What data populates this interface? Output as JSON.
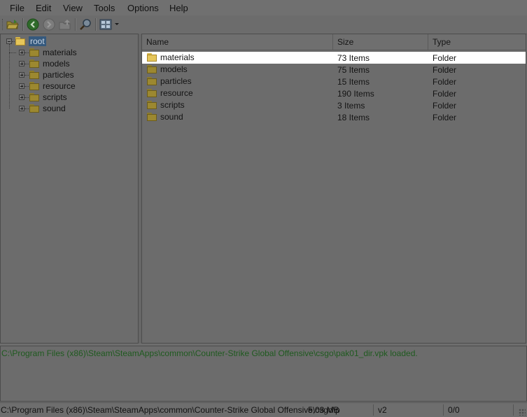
{
  "menu": [
    "File",
    "Edit",
    "View",
    "Tools",
    "Options",
    "Help"
  ],
  "toolbar": {
    "icons": [
      "open-icon",
      "back-icon",
      "forward-icon",
      "up-icon",
      "find-icon",
      "view-mode-icon"
    ]
  },
  "tree": {
    "root_label": "root",
    "children": [
      "materials",
      "models",
      "particles",
      "resource",
      "scripts",
      "sound"
    ]
  },
  "list": {
    "columns": [
      "Name",
      "Size",
      "Type"
    ],
    "rows": [
      {
        "name": "materials",
        "size": "73 Items",
        "type": "Folder",
        "selected": true
      },
      {
        "name": "models",
        "size": "75 Items",
        "type": "Folder"
      },
      {
        "name": "particles",
        "size": "15 Items",
        "type": "Folder"
      },
      {
        "name": "resource",
        "size": "190 Items",
        "type": "Folder"
      },
      {
        "name": "scripts",
        "size": "3 Items",
        "type": "Folder"
      },
      {
        "name": "sound",
        "size": "18 Items",
        "type": "Folder"
      }
    ]
  },
  "log": {
    "message": "C:\\Program Files (x86)\\Steam\\SteamApps\\common\\Counter-Strike Global Offensive\\csgo\\pak01_dir.vpk loaded."
  },
  "status": {
    "path": "C:\\Program Files (x86)\\Steam\\SteamApps\\common\\Counter-Strike Global Offensive\\csgo\\p",
    "size": "5,03 MB",
    "version": "v2",
    "count": "0/0"
  },
  "colors": {
    "log_text": "#1f5a1f",
    "selection": "#ffffff",
    "root_highlight": "#35597d"
  }
}
